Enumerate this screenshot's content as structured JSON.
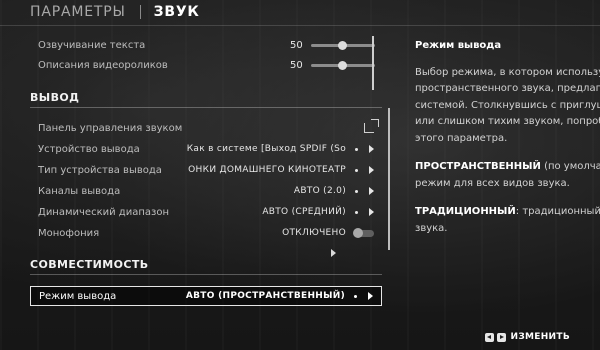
{
  "tabs": [
    {
      "label": "ПАРАМЕТРЫ",
      "active": false
    },
    {
      "label": "ЗВУК",
      "active": true
    }
  ],
  "sliders": [
    {
      "label": "Озвучивание текста",
      "value": 50
    },
    {
      "label": "Описания видеороликов",
      "value": 50
    }
  ],
  "sections": {
    "output": "ВЫВОД",
    "compat": "СОВМЕСТИМОСТЬ"
  },
  "output_items": [
    {
      "label": "Панель управления звуком",
      "value": "",
      "icon": "external-link-icon"
    },
    {
      "label": "Устройство вывода",
      "value": "Как в системе [Выход SPDIF (So"
    },
    {
      "label": "Тип устройства вывода",
      "value": "ОНКИ ДОМАШНЕГО КИНОТЕАТР"
    },
    {
      "label": "Каналы вывода",
      "value": "АВТО (2.0)"
    },
    {
      "label": "Динамический диапазон",
      "value": "АВТО (СРЕДНИЙ)"
    },
    {
      "label": "Монофония",
      "value": "ОТКЛЮЧЕНО",
      "icon": "toggle-icon"
    }
  ],
  "selected_item": {
    "label": "Режим вывода",
    "value": "АВТО (ПРОСТРАНСТВЕННЫЙ)"
  },
  "info": {
    "title": "Режим вывода",
    "lines": [
      "Выбор режима, в котором использует",
      "пространственного звука, предлагаем",
      "системой. Столкнувшись с приглушён",
      "или слишком тихим звуком, попробуйт",
      "этого параметра."
    ],
    "spatial_term": "ПРОСТРАНСТВЕННЫЙ",
    "spatial_rest": " (по умолчанию",
    "spatial_line2": "режим для всех видов звука.",
    "traditional_term": "ТРАДИЦИОННЫЙ",
    "traditional_rest": ": традиционный реж",
    "traditional_line2": "звука."
  },
  "hint": {
    "label": "ИЗМЕНИТЬ"
  }
}
